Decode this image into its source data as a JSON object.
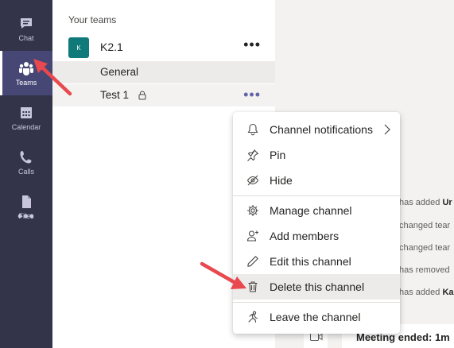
{
  "rail": {
    "items": [
      {
        "label": "Chat",
        "icon": "chat-icon"
      },
      {
        "label": "Teams",
        "icon": "teams-icon",
        "active": true
      },
      {
        "label": "Calendar",
        "icon": "calendar-icon"
      },
      {
        "label": "Calls",
        "icon": "phone-icon"
      },
      {
        "label": "Files",
        "icon": "file-icon"
      }
    ],
    "more_label": "•••"
  },
  "teams_pane": {
    "section_label": "Your teams",
    "team": {
      "avatar_text": "K",
      "name": "K2.1",
      "more_label": "•••"
    },
    "channels": [
      {
        "name": "General"
      },
      {
        "name": "Test 1",
        "locked": true,
        "more_label": "•••"
      }
    ]
  },
  "context_menu": {
    "items": [
      {
        "label": "Channel notifications",
        "icon": "bell-icon",
        "has_submenu": true
      },
      {
        "label": "Pin",
        "icon": "pin-icon"
      },
      {
        "label": "Hide",
        "icon": "hide-icon"
      },
      {
        "label": "Manage channel",
        "icon": "gear-icon"
      },
      {
        "label": "Add members",
        "icon": "add-person-icon"
      },
      {
        "label": "Edit this channel",
        "icon": "pencil-icon"
      },
      {
        "label": "Delete this channel",
        "icon": "trash-icon",
        "highlighted": true
      },
      {
        "label": "Leave the channel",
        "icon": "leave-icon"
      }
    ]
  },
  "chat_background": {
    "activity_lines": [
      {
        "prefix": "has added ",
        "bold": "Ur"
      },
      {
        "prefix": "changed tear",
        "bold": ""
      },
      {
        "prefix": "changed tear",
        "bold": ""
      },
      {
        "prefix": "has removed",
        "bold": ""
      },
      {
        "prefix": "has added ",
        "bold": "Ka"
      }
    ],
    "meeting_text": "Meeting ended: 1m"
  },
  "colors": {
    "rail_bg": "#33344a",
    "rail_active": "#464775",
    "accent": "#6264a7",
    "team_avatar": "#10797a",
    "annotation_arrow": "#e8484e"
  }
}
